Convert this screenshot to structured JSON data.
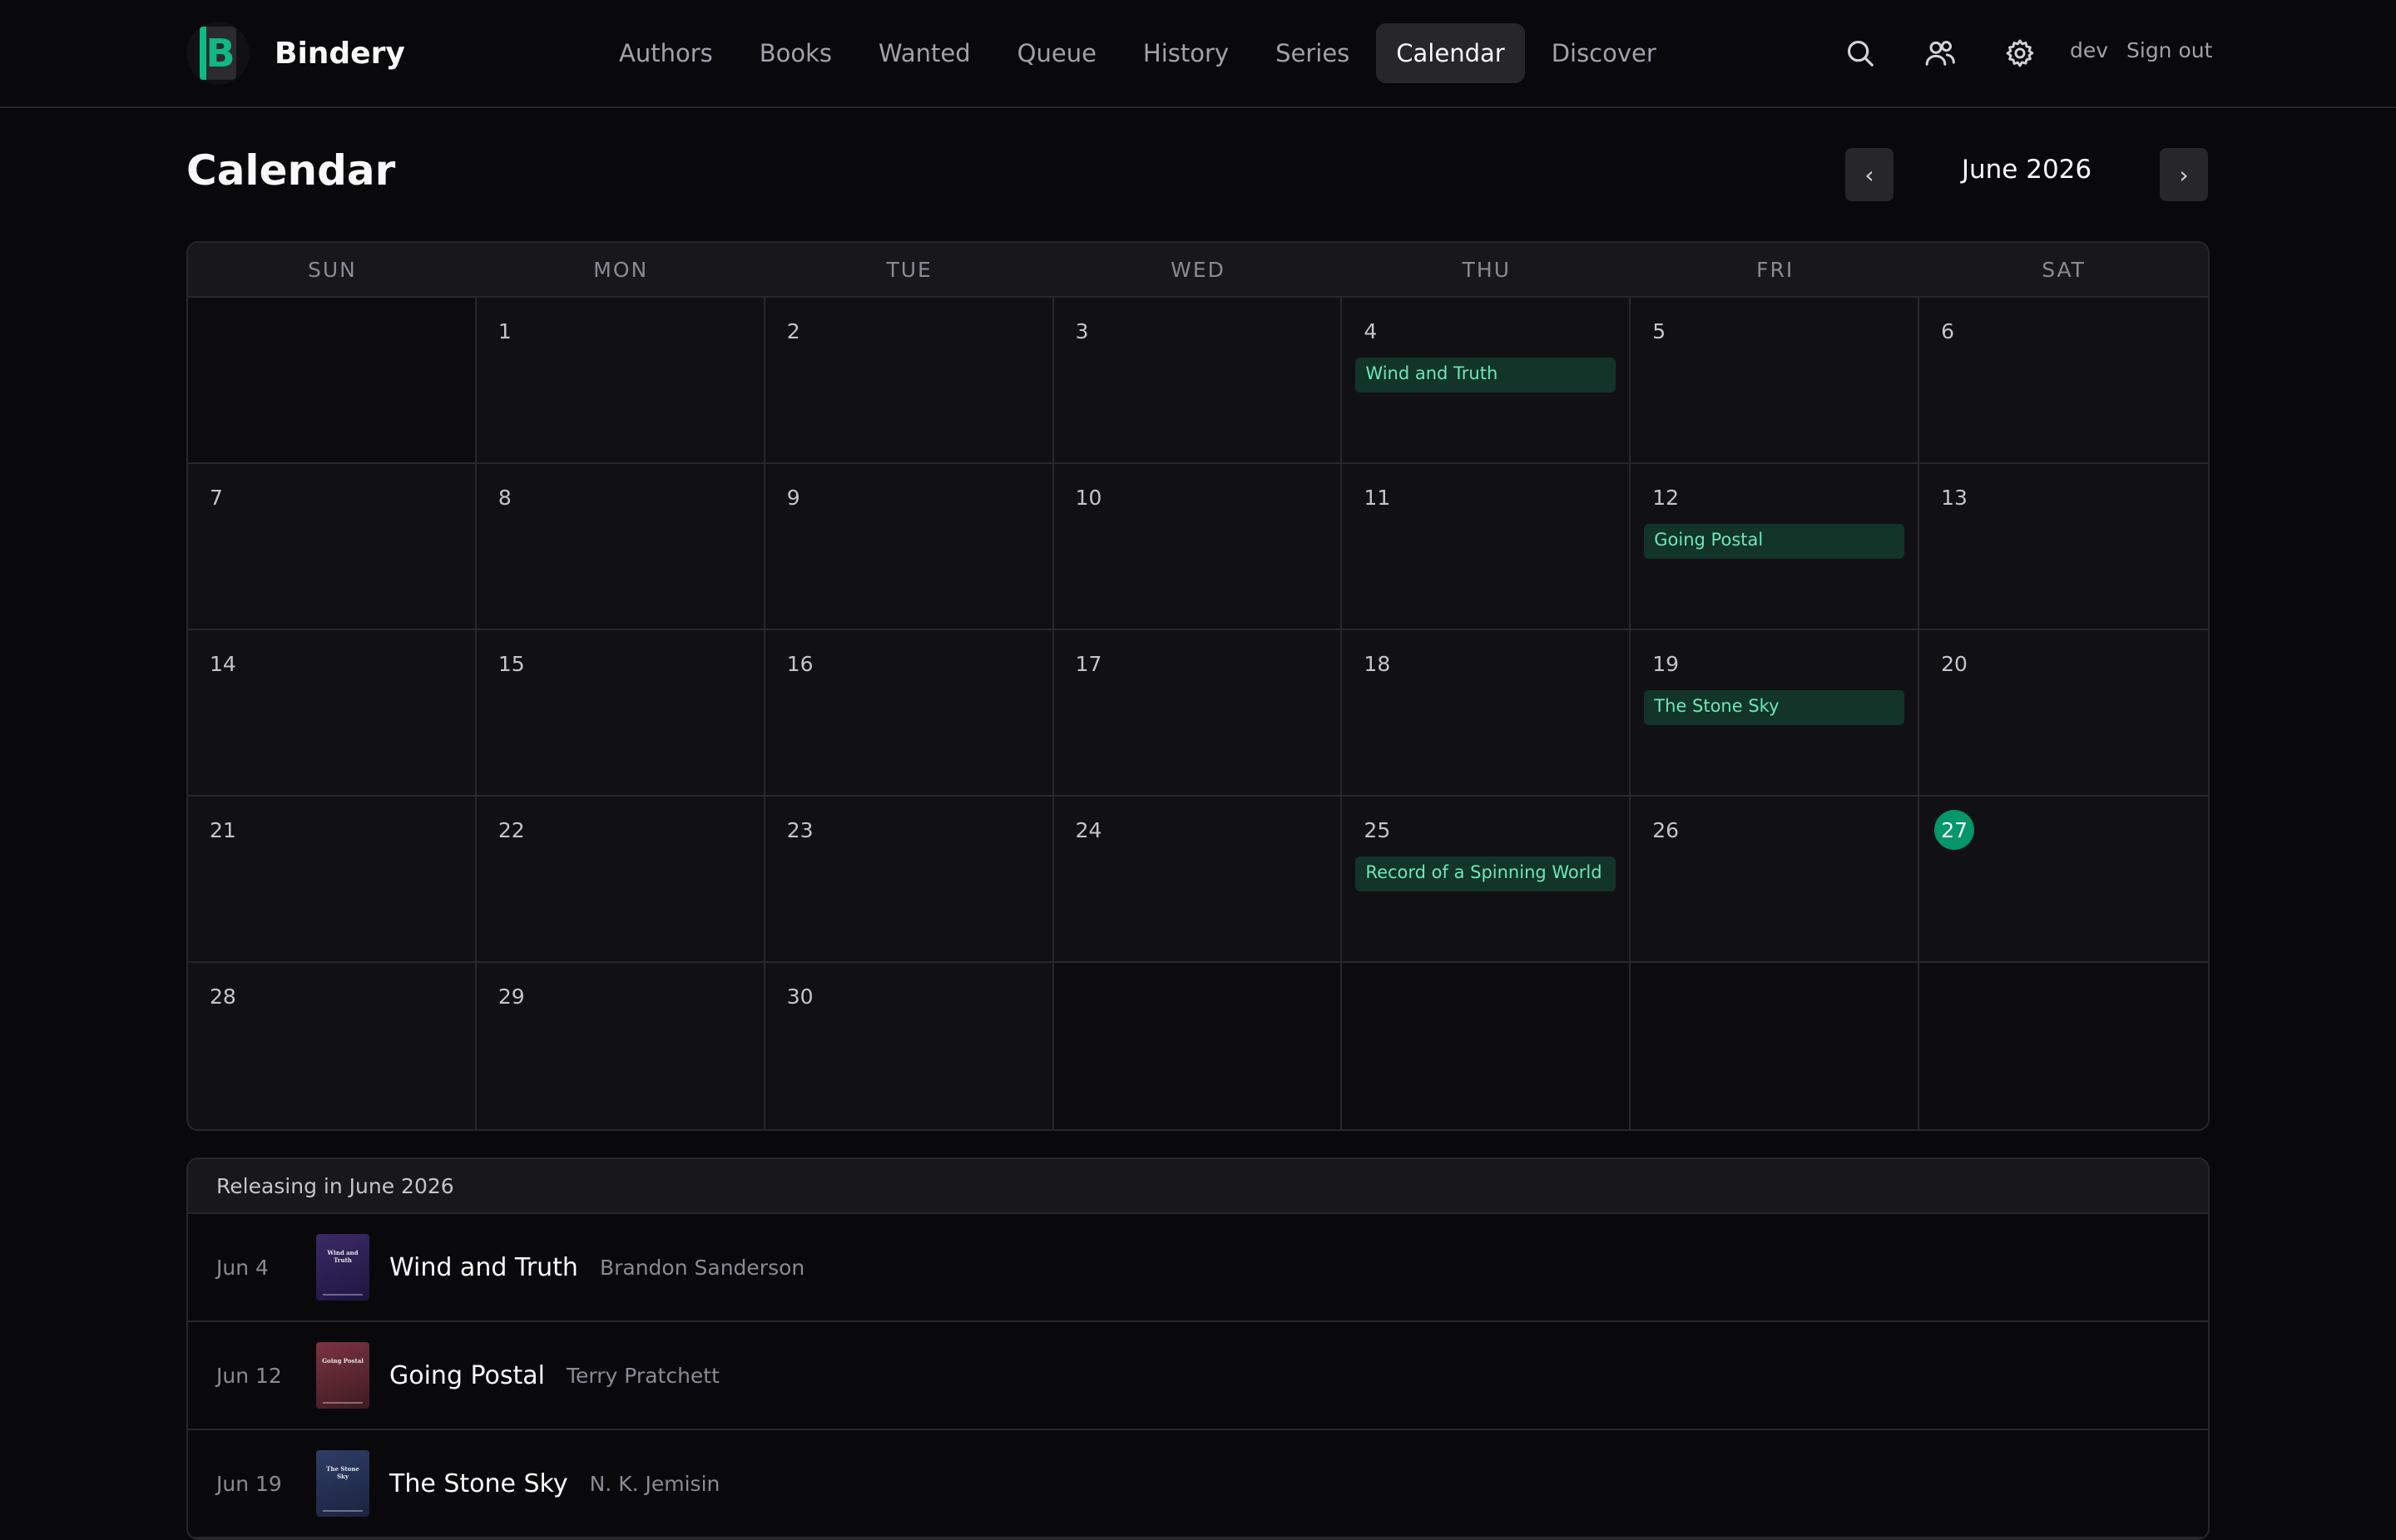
{
  "app": {
    "name": "Bindery",
    "logo_letter": "B",
    "accent_color": "#10b981",
    "today_color": "#059669"
  },
  "nav": {
    "items": [
      {
        "label": "Authors",
        "active": false
      },
      {
        "label": "Books",
        "active": false
      },
      {
        "label": "Wanted",
        "active": false
      },
      {
        "label": "Queue",
        "active": false
      },
      {
        "label": "History",
        "active": false
      },
      {
        "label": "Series",
        "active": false
      },
      {
        "label": "Calendar",
        "active": true
      },
      {
        "label": "Discover",
        "active": false
      }
    ]
  },
  "header_actions": {
    "icons": [
      "search-icon",
      "users-icon",
      "gear-icon"
    ],
    "user": "dev",
    "sign_out": "Sign out"
  },
  "page": {
    "title": "Calendar",
    "month_label": "June 2026",
    "prev_label": "‹",
    "next_label": "›"
  },
  "calendar": {
    "weekdays": [
      "SUN",
      "MON",
      "TUE",
      "WED",
      "THU",
      "FRI",
      "SAT"
    ],
    "first_weekday_index": 1,
    "days_in_month": 30,
    "today": 27,
    "events": [
      {
        "day": 4,
        "title": "Wind and Truth"
      },
      {
        "day": 12,
        "title": "Going Postal"
      },
      {
        "day": 19,
        "title": "The Stone Sky"
      },
      {
        "day": 25,
        "title": "Record of a Spinning World"
      }
    ]
  },
  "releases": {
    "heading": "Releasing in June 2026",
    "items": [
      {
        "date": "Jun 4",
        "title": "Wind and Truth",
        "author": "Brandon Sanderson",
        "cover_title": "Wind and Truth",
        "cover_colors": [
          "#3b2a66",
          "#1e1540"
        ]
      },
      {
        "date": "Jun 12",
        "title": "Going Postal",
        "author": "Terry Pratchett",
        "cover_title": "Going Postal",
        "cover_colors": [
          "#7a3440",
          "#3f1a22"
        ]
      },
      {
        "date": "Jun 19",
        "title": "The Stone Sky",
        "author": "N. K. Jemisin",
        "cover_title": "The Stone Sky",
        "cover_colors": [
          "#2e3d66",
          "#1a2340"
        ]
      }
    ]
  }
}
